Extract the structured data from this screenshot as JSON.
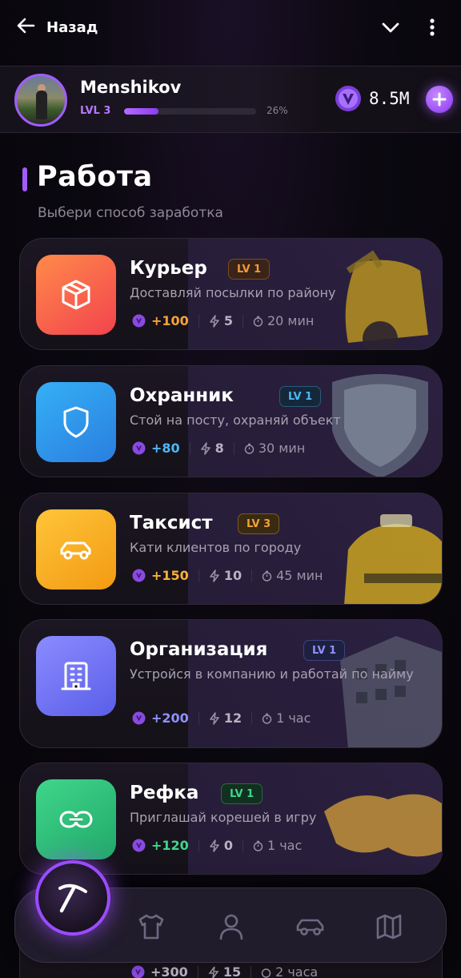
{
  "topbar": {
    "back_label": "Назад"
  },
  "profile": {
    "name": "Menshikov",
    "level": "LVL 3",
    "progress_percent": 26,
    "progress_label": "26%",
    "balance": "8.5M"
  },
  "section": {
    "title": "Работа",
    "subtitle": "Выбери способ заработка"
  },
  "jobs": [
    {
      "name": "Курьер",
      "level": "LV 1",
      "desc": "Доставляй посылки по району",
      "reward": "+100",
      "energy": "5",
      "time": "20 мин",
      "tile_color": "#f45d4a",
      "reward_color": "#f7a23a"
    },
    {
      "name": "Охранник",
      "level": "LV 1",
      "desc": "Стой на посту, охраняй объект",
      "reward": "+80",
      "energy": "8",
      "time": "30 мин",
      "tile_color": "#2a95e6",
      "reward_color": "#4bb8f5"
    },
    {
      "name": "Таксист",
      "level": "LV 3",
      "desc": "Кати клиентов по городу",
      "reward": "+150",
      "energy": "10",
      "time": "45 мин",
      "tile_color": "#f5a31a",
      "reward_color": "#f7b13a"
    },
    {
      "name": "Организация",
      "level": "LV 1",
      "desc": "Устройся в компанию и работай по найму",
      "reward": "+200",
      "energy": "12",
      "time": "1 час",
      "tile_color": "#6c6ef2",
      "reward_color": "#8f91ff"
    },
    {
      "name": "Рефка",
      "level": "LV 1",
      "desc": "Приглашай корешей в игру",
      "reward": "+120",
      "energy": "0",
      "time": "1 час",
      "tile_color": "#2cc27a",
      "reward_color": "#3fd68a"
    }
  ],
  "peek": {
    "reward": "+300",
    "energy": "15",
    "time": "2 часа"
  },
  "nav": {
    "items": [
      "pickaxe-icon",
      "shirt-icon",
      "user-icon",
      "car-icon",
      "map-icon"
    ]
  }
}
